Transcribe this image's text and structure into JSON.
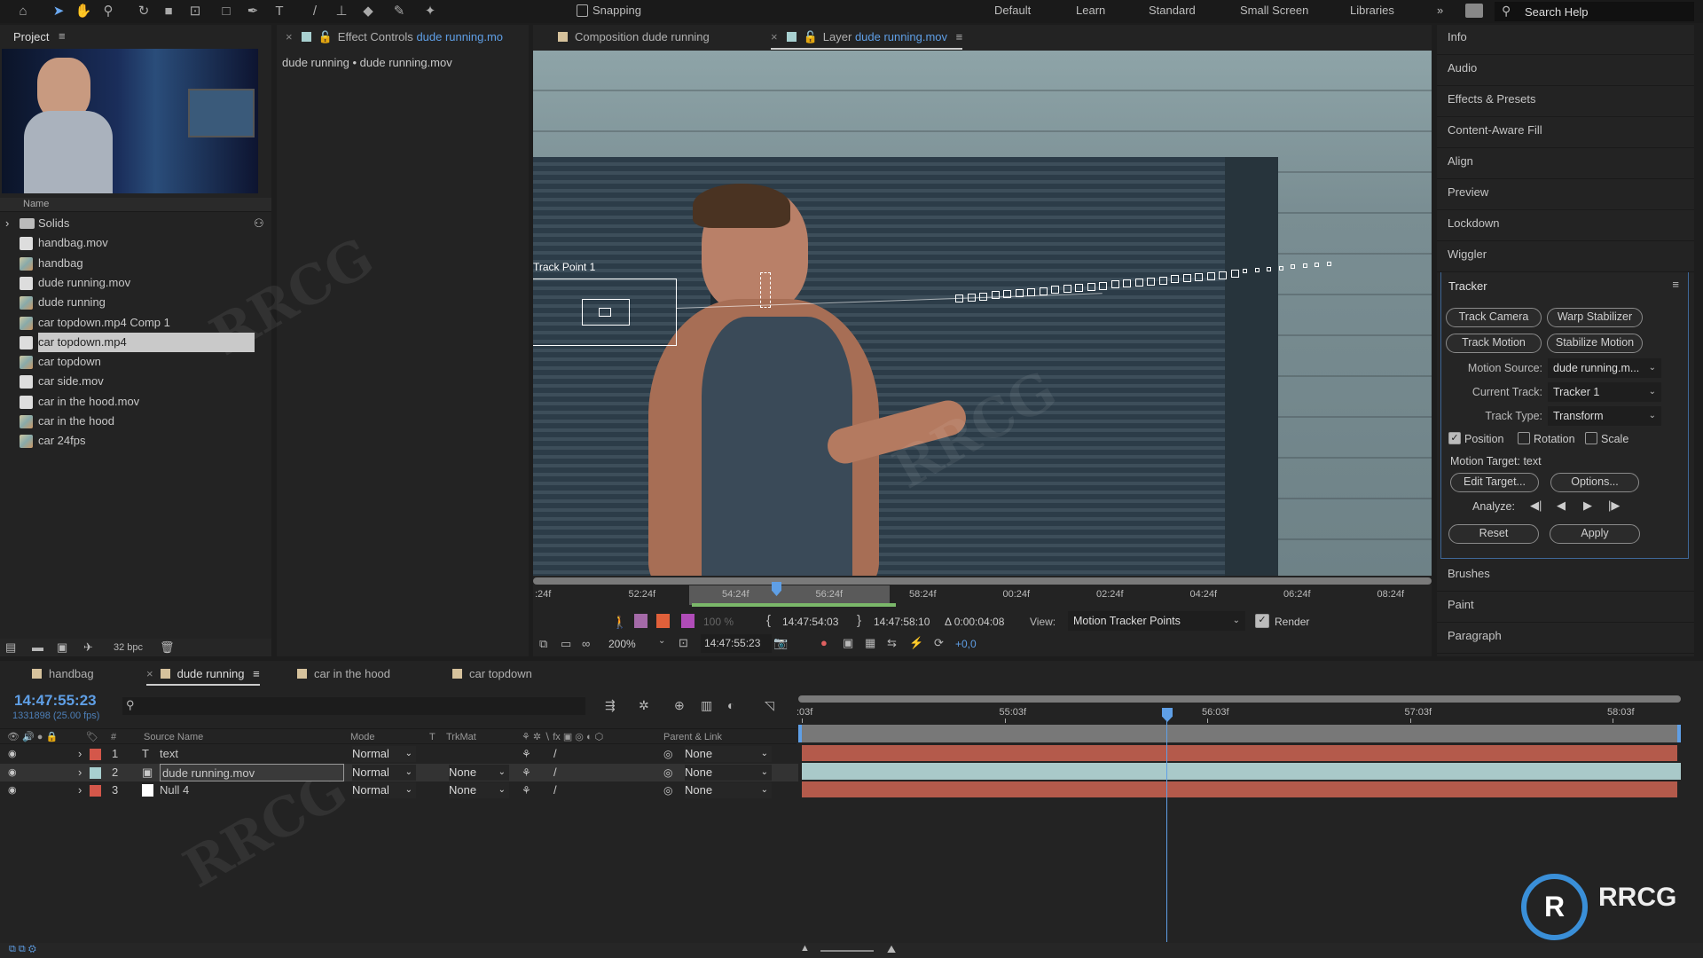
{
  "toolbar": {
    "snapping": "Snapping",
    "workspaces": [
      "Default",
      "Learn",
      "Standard",
      "Small Screen",
      "Libraries"
    ],
    "more": "»",
    "search": "Search Help"
  },
  "project": {
    "title": "Project",
    "column_name": "Name",
    "items": [
      {
        "label": "Solids",
        "type": "folder"
      },
      {
        "label": "handbag.mov",
        "type": "footage"
      },
      {
        "label": "handbag",
        "type": "comp"
      },
      {
        "label": "dude running.mov",
        "type": "footage"
      },
      {
        "label": "dude running",
        "type": "comp"
      },
      {
        "label": "car topdown.mp4 Comp 1",
        "type": "comp"
      },
      {
        "label": "car topdown.mp4",
        "type": "footage",
        "selected": true
      },
      {
        "label": "car topdown",
        "type": "comp"
      },
      {
        "label": "car side.mov",
        "type": "footage"
      },
      {
        "label": "car in the hood.mov",
        "type": "footage"
      },
      {
        "label": "car in the hood",
        "type": "comp"
      },
      {
        "label": "car 24fps",
        "type": "comp"
      }
    ],
    "bpc": "32 bpc"
  },
  "effect_controls": {
    "tab_prefix": "Effect Controls",
    "tab_name": "dude running.mo",
    "subtitle": "dude running • dude running.mov"
  },
  "viewer": {
    "tab_comp": "Composition dude running",
    "tab_layer_prefix": "Layer",
    "tab_layer_name": "dude running.mov",
    "track_point_label": "Track Point 1",
    "ruler_ticks": [
      ":24f",
      "52:24f",
      "54:24f",
      "56:24f",
      "58:24f",
      "00:24f",
      "02:24f",
      "04:24f",
      "06:24f",
      "08:24f"
    ],
    "opacity": "100 %",
    "in_point": "14:47:54:03",
    "out_point": "14:47:58:10",
    "duration": "Δ 0:00:04:08",
    "view_label": "View:",
    "view_value": "Motion Tracker Points",
    "render_label": "Render",
    "render_checked": true,
    "zoom": "200%",
    "timecode": "14:47:55:23",
    "exposure": "+0,0"
  },
  "right_panel": {
    "items_top": [
      "Info",
      "Audio",
      "Effects & Presets",
      "Content-Aware Fill",
      "Align",
      "Preview",
      "Lockdown",
      "Wiggler"
    ],
    "items_bottom": [
      "Brushes",
      "Paint",
      "Paragraph"
    ]
  },
  "tracker": {
    "title": "Tracker",
    "track_camera": "Track Camera",
    "warp_stabilizer": "Warp Stabilizer",
    "track_motion": "Track Motion",
    "stabilize_motion": "Stabilize Motion",
    "motion_source_label": "Motion Source:",
    "motion_source": "dude running.m...",
    "current_track_label": "Current Track:",
    "current_track": "Tracker 1",
    "track_type_label": "Track Type:",
    "track_type": "Transform",
    "position": "Position",
    "position_checked": true,
    "rotation": "Rotation",
    "rotation_checked": false,
    "scale": "Scale",
    "scale_checked": false,
    "motion_target": "Motion Target: text",
    "edit_target": "Edit Target...",
    "options": "Options...",
    "analyze_label": "Analyze:",
    "reset": "Reset",
    "apply": "Apply"
  },
  "timeline": {
    "tabs": [
      "handbag",
      "dude running",
      "car in the hood",
      "car topdown"
    ],
    "active_tab": "dude running",
    "timecode": "14:47:55:23",
    "frames": "1331898 (25.00 fps)",
    "headers": {
      "num": "#",
      "source": "Source Name",
      "mode": "Mode",
      "t": "T",
      "trkmat": "TrkMat",
      "parent": "Parent & Link"
    },
    "layers": [
      {
        "num": "1",
        "name": "text",
        "type": "text",
        "color": "#d4574a",
        "mode": "Normal",
        "trkmat": "",
        "parent": "None"
      },
      {
        "num": "2",
        "name": "dude running.mov",
        "type": "footage",
        "color": "#a8d0d0",
        "mode": "Normal",
        "trkmat": "None",
        "parent": "None"
      },
      {
        "num": "3",
        "name": "Null 4",
        "type": "null",
        "color": "#d4574a",
        "mode": "Normal",
        "trkmat": "None",
        "parent": "None"
      }
    ],
    "ruler_ticks": [
      ":03f",
      "55:03f",
      "56:03f",
      "57:03f",
      "58:03f"
    ]
  },
  "colors": {
    "accent": "#5f9fe6",
    "layer_red": "#b45a4b",
    "layer_teal": "#a9c9c9"
  }
}
